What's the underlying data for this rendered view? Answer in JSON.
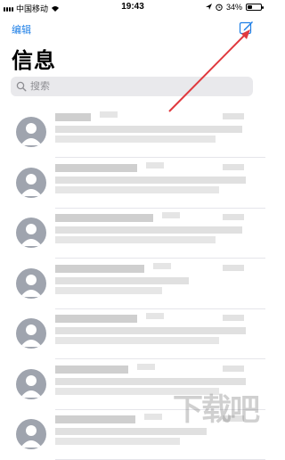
{
  "status_bar": {
    "carrier": "中国移动",
    "time": "19:43",
    "battery": "34%",
    "battery_level": 0.34
  },
  "nav": {
    "edit_label": "编辑",
    "title": "信息"
  },
  "search": {
    "placeholder": "搜索"
  },
  "conversations": [
    {
      "id": 1
    },
    {
      "id": 2
    },
    {
      "id": 3
    },
    {
      "id": 4
    },
    {
      "id": 5
    },
    {
      "id": 6
    },
    {
      "id": 7
    }
  ],
  "icons": {
    "compose": "compose-icon",
    "search": "search-icon",
    "avatar": "person-icon"
  },
  "colors": {
    "accent": "#1e7fe6",
    "annotation_arrow": "#e0393e",
    "avatar_bg": "#9fa4ae"
  },
  "watermark": {
    "text": "下载吧"
  }
}
